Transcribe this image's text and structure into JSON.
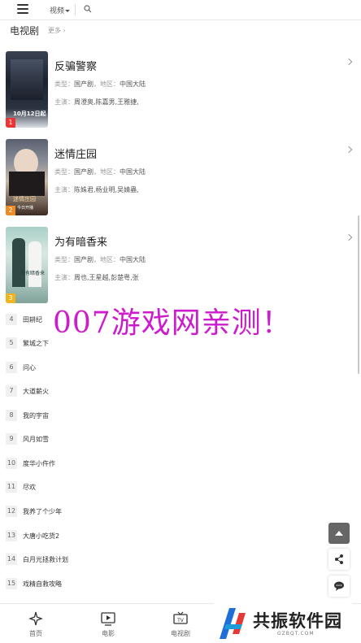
{
  "header": {
    "nav_type": "视频",
    "section_title": "电视剧",
    "section_more": "更多 ›"
  },
  "featured": [
    {
      "rank": "1",
      "title": "反骗警察",
      "type_label": "类型：",
      "type_value": "国产剧",
      "region_label": "，地区：",
      "region_value": "中国大陆",
      "cast_label": "主演：",
      "cast_value": "周澄奥,陈嘉男,王雅捷,",
      "poster_caption": "10月12日起",
      "poster_sub": "",
      "rank_color": "#e33"
    },
    {
      "rank": "2",
      "title": "迷情庄园",
      "type_label": "类型：",
      "type_value": "国产剧",
      "region_label": "，地区：",
      "region_value": "中国大陆",
      "cast_label": "主演：",
      "cast_value": "陈姝君,杨业明,吴婧蟲,",
      "poster_caption": "迷情庄园",
      "poster_sub": "今日开播",
      "rank_color": "#f08a24"
    },
    {
      "rank": "3",
      "title": "为有暗香来",
      "type_label": "类型：",
      "type_value": "国产剧",
      "region_label": "，地区：",
      "region_value": "中国大陆",
      "cast_label": "主演：",
      "cast_value": "周也,王星越,彭楚粤,张",
      "poster_caption": "为有暗香来",
      "poster_sub": "",
      "rank_color": "#f0b41e"
    }
  ],
  "list": [
    {
      "num": "4",
      "name": "田耕纪"
    },
    {
      "num": "5",
      "name": "繁城之下"
    },
    {
      "num": "6",
      "name": "问心"
    },
    {
      "num": "7",
      "name": "大道薪火"
    },
    {
      "num": "8",
      "name": "我的宇宙"
    },
    {
      "num": "9",
      "name": "风月如雪"
    },
    {
      "num": "10",
      "name": "度华小仵作"
    },
    {
      "num": "11",
      "name": "尽欢"
    },
    {
      "num": "12",
      "name": "我养了个少年"
    },
    {
      "num": "13",
      "name": "大唐小吃货2"
    },
    {
      "num": "14",
      "name": "白月光拯救计划"
    },
    {
      "num": "15",
      "name": "戏精自救攻略"
    }
  ],
  "watermark": "007游戏网亲测！",
  "bottom_nav": {
    "home": "首页",
    "movie": "电影",
    "tv": "电视剧"
  },
  "logo": {
    "name": "共振软件园",
    "url": "GZBQT.COM"
  },
  "colors": {
    "watermark": "#cc1ccc",
    "logo_blue": "#1e6fd9",
    "logo_red": "#e53935"
  }
}
